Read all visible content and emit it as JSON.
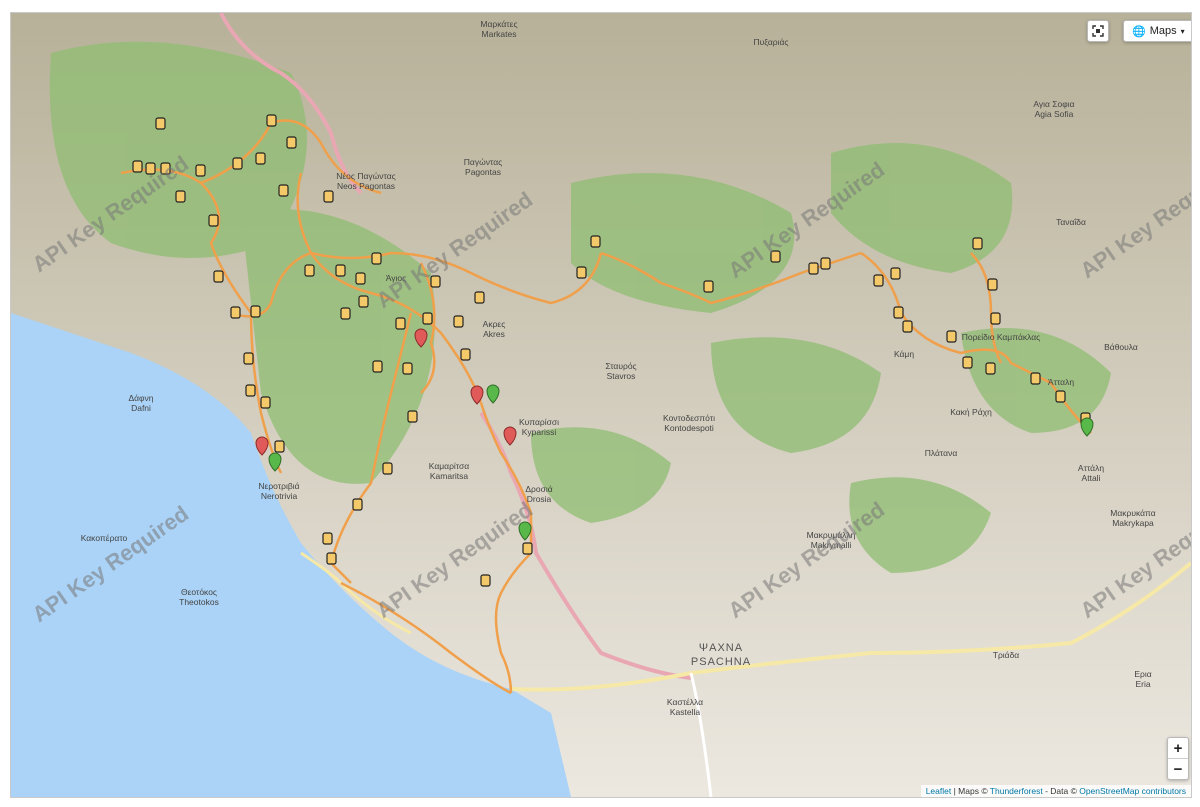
{
  "map": {
    "controls": {
      "layer_label": "Maps",
      "zoom_in": "+",
      "zoom_out": "−"
    },
    "attribution": {
      "leaflet": "Leaflet",
      "sep1": " | ",
      "maps": "Maps © ",
      "thunderforest": "Thunderforest",
      "data": " - Data © ",
      "osm": "OpenStreetMap contributors"
    },
    "watermark_text": "API Key Required",
    "places": [
      {
        "greek": "Μαρκάτες",
        "latin": "Markates"
      },
      {
        "greek": "Πυξαριάς",
        "latin": ""
      },
      {
        "greek": "Αγια Σοφια",
        "latin": "Agia Sofia"
      },
      {
        "greek": "Νέος Παγώντας",
        "latin": "Neos Pagontas"
      },
      {
        "greek": "Παγώντας",
        "latin": "Pagontas"
      },
      {
        "greek": "Ταναΐδα",
        "latin": ""
      },
      {
        "greek": "Άγιος",
        "latin": ""
      },
      {
        "greek": "Ακρες",
        "latin": "Akres"
      },
      {
        "greek": "Πορείδιο Καμπάκλας",
        "latin": ""
      },
      {
        "greek": "Βάθουλα",
        "latin": ""
      },
      {
        "greek": "Κάμη",
        "latin": ""
      },
      {
        "greek": "Σταυρός",
        "latin": "Stavros"
      },
      {
        "greek": "Δάφνη",
        "latin": "Dafni"
      },
      {
        "greek": "Κυπαρίσσι",
        "latin": "Kyparissi"
      },
      {
        "greek": "Κοντοδεσπότι",
        "latin": "Kontodespoti"
      },
      {
        "greek": "Κακή Ράχη",
        "latin": ""
      },
      {
        "greek": "Άτταλη",
        "latin": ""
      },
      {
        "greek": "Πλάτανα",
        "latin": ""
      },
      {
        "greek": "Αττάλη",
        "latin": "Attali"
      },
      {
        "greek": "Νεροτριβιά",
        "latin": "Nerotrivia"
      },
      {
        "greek": "Καμαρίτσα",
        "latin": "Kamaritsa"
      },
      {
        "greek": "Δροσιά",
        "latin": "Drosia"
      },
      {
        "greek": "Μακρυκάπα",
        "latin": "Makrykapa"
      },
      {
        "greek": "Κακοπέρατο",
        "latin": ""
      },
      {
        "greek": "Μακρυμάλλη",
        "latin": "Makrymalli"
      },
      {
        "greek": "Θεοτόκος",
        "latin": "Theotokos"
      },
      {
        "greek": "ΨΑΧΝΑ",
        "latin": "PSACHNA"
      },
      {
        "greek": "Τριάδα",
        "latin": ""
      },
      {
        "greek": "Καστέλλα",
        "latin": "Kastella"
      },
      {
        "greek": "Ερια",
        "latin": "Eria"
      }
    ],
    "colors": {
      "trail": "#f0a04b",
      "sea": "#aad3f7",
      "forest": "#8fbd72",
      "route_pink": "#e8a7b3"
    }
  }
}
